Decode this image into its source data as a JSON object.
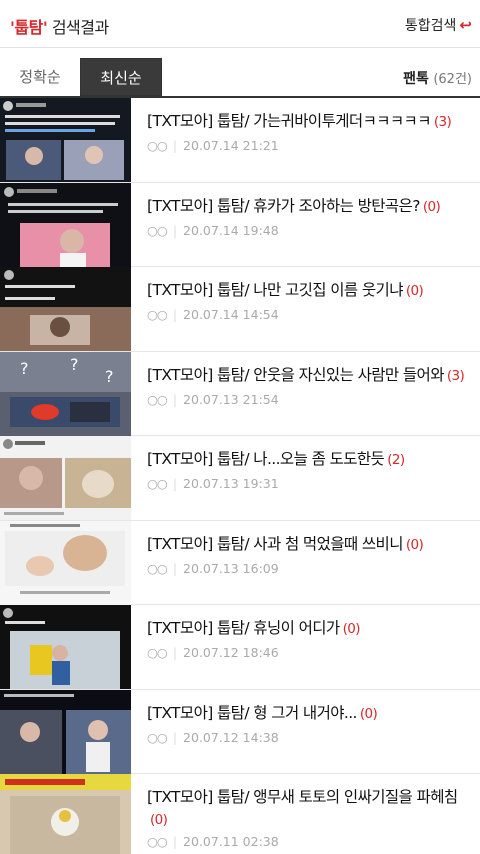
{
  "header": {
    "keyword": "'툽탐'",
    "title_rest": " 검색결과",
    "all_search": "통합검색",
    "all_search_icon": "return-arrow-icon"
  },
  "tabs": {
    "accuracy": "정확순",
    "latest": "최신순"
  },
  "board": {
    "name": "팬톡",
    "count": "(62건)"
  },
  "results": [
    {
      "title": "[TXT모아] 툽탐/ 가는귀바이투게더ㅋㅋㅋㅋㅋ",
      "comments": "(3)",
      "user": "○○",
      "date": "20.07.14 21:21"
    },
    {
      "title": "[TXT모아] 툽탐/ 휴카가 조아하는 방탄곡은?",
      "comments": "(0)",
      "user": "○○",
      "date": "20.07.14 19:48"
    },
    {
      "title": "[TXT모아] 툽탐/ 나만 고깃집 이름 웃기냐",
      "comments": "(0)",
      "user": "○○",
      "date": "20.07.14 14:54"
    },
    {
      "title": "[TXT모아] 툽탐/ 안웃을 자신있는 사람만 들어와",
      "comments": "(3)",
      "user": "○○",
      "date": "20.07.13 21:54"
    },
    {
      "title": "[TXT모아] 툽탐/ 나...오늘 좀 도도한듯",
      "comments": "(2)",
      "user": "○○",
      "date": "20.07.13 19:31"
    },
    {
      "title": "[TXT모아] 툽탐/ 사과 첨 먹었을때 쓰비니",
      "comments": "(0)",
      "user": "○○",
      "date": "20.07.13 16:09"
    },
    {
      "title": "[TXT모아] 툽탐/ 휴닝이 어디가",
      "comments": "(0)",
      "user": "○○",
      "date": "20.07.12 18:46"
    },
    {
      "title": "[TXT모아] 툽탐/ 형 그거 내거야...",
      "comments": "(0)",
      "user": "○○",
      "date": "20.07.12 14:38"
    },
    {
      "title": "[TXT모아] 툽탐/ 앵무새 토토의 인싸기질을 파헤침",
      "comments": "(0)",
      "user": "○○",
      "date": "20.07.11 02:38"
    }
  ],
  "colors": {
    "accent": "#d8262b",
    "tab_active_bg": "#3a3a3a"
  }
}
